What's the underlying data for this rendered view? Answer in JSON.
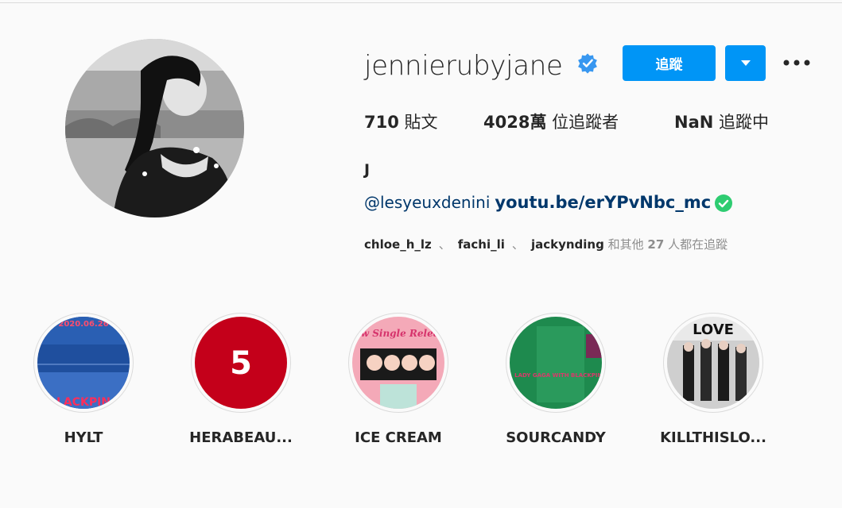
{
  "profile": {
    "username": "jennierubyjane",
    "follow_label": "追蹤",
    "full_name": "J",
    "stats": {
      "posts_count": "710",
      "posts_label": "貼文",
      "followers_count": "4028萬",
      "followers_label": "位追蹤者",
      "following_count": "NaN",
      "following_label": "追蹤中"
    },
    "bio": {
      "mention": "@lesyeuxdenini",
      "link": "youtu.be/erYPvNbc_mc"
    },
    "followed_by": {
      "names": [
        "chloe_h_lz",
        "fachi_li",
        "jackynding"
      ],
      "separator": "、",
      "prefix": "和其他",
      "count": "27",
      "suffix": "人都在追蹤"
    }
  },
  "highlights": [
    {
      "label": "HYLT",
      "cover_text": "LACKPIN",
      "cover_top": "2020.06.26"
    },
    {
      "label": "HERABEAU...",
      "cover_text": "5"
    },
    {
      "label": "ICE CREAM",
      "cover_text": "New Single Release"
    },
    {
      "label": "SOURCANDY",
      "cover_text": "LADY GAGA WITH BLACKPINK"
    },
    {
      "label": "KILLTHISLO...",
      "cover_text": "LOVE"
    }
  ],
  "colors": {
    "accent": "#0095f6",
    "link": "#00376b",
    "verified": "#3897f0",
    "check_green": "#2ecc71",
    "muted": "#8e8e8e"
  },
  "icons": {
    "verified": "verified-badge-icon",
    "dropdown": "chevron-down-icon",
    "more": "more-options-icon",
    "bio_check": "check-circle-icon"
  }
}
